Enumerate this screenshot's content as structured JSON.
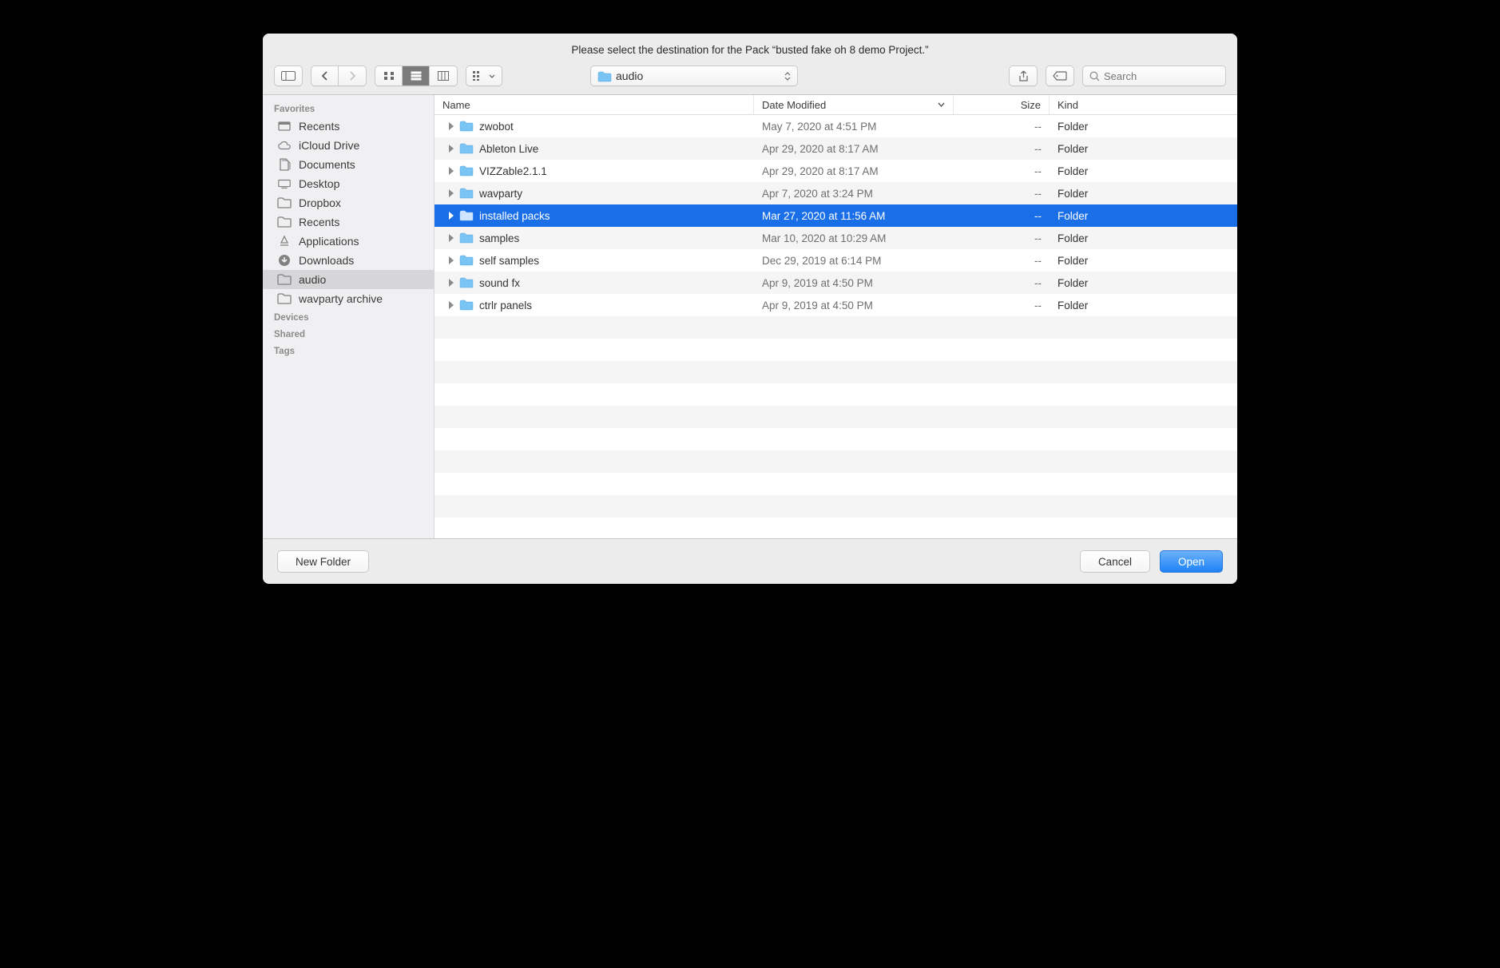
{
  "title": "Please select the destination for the Pack “busted fake oh 8 demo Project.”",
  "path_popup": {
    "label": "audio"
  },
  "search": {
    "placeholder": "Search"
  },
  "sidebar": {
    "sections": {
      "favorites": "Favorites",
      "devices": "Devices",
      "shared": "Shared",
      "tags": "Tags"
    },
    "items": [
      {
        "label": "Recents",
        "icon": "recents"
      },
      {
        "label": "iCloud Drive",
        "icon": "cloud"
      },
      {
        "label": "Documents",
        "icon": "documents"
      },
      {
        "label": "Desktop",
        "icon": "desktop"
      },
      {
        "label": "Dropbox",
        "icon": "folder"
      },
      {
        "label": "Recents",
        "icon": "folder"
      },
      {
        "label": "Applications",
        "icon": "applications"
      },
      {
        "label": "Downloads",
        "icon": "downloads"
      },
      {
        "label": "audio",
        "icon": "folder",
        "active": true
      },
      {
        "label": "wavparty archive",
        "icon": "folder"
      }
    ]
  },
  "columns": {
    "name": "Name",
    "date": "Date Modified",
    "size": "Size",
    "kind": "Kind"
  },
  "rows": [
    {
      "name": "zwobot",
      "date": "May 7, 2020 at 4:51 PM",
      "size": "--",
      "kind": "Folder"
    },
    {
      "name": "Ableton Live",
      "date": "Apr 29, 2020 at 8:17 AM",
      "size": "--",
      "kind": "Folder"
    },
    {
      "name": "VIZZable2.1.1",
      "date": "Apr 29, 2020 at 8:17 AM",
      "size": "--",
      "kind": "Folder"
    },
    {
      "name": "wavparty",
      "date": "Apr 7, 2020 at 3:24 PM",
      "size": "--",
      "kind": "Folder"
    },
    {
      "name": "installed packs",
      "date": "Mar 27, 2020 at 11:56 AM",
      "size": "--",
      "kind": "Folder",
      "selected": true
    },
    {
      "name": "samples",
      "date": "Mar 10, 2020 at 10:29 AM",
      "size": "--",
      "kind": "Folder"
    },
    {
      "name": "self samples",
      "date": "Dec 29, 2019 at 6:14 PM",
      "size": "--",
      "kind": "Folder"
    },
    {
      "name": "sound fx",
      "date": "Apr 9, 2019 at 4:50 PM",
      "size": "--",
      "kind": "Folder"
    },
    {
      "name": "ctrlr panels",
      "date": "Apr 9, 2019 at 4:50 PM",
      "size": "--",
      "kind": "Folder"
    }
  ],
  "footer": {
    "new_folder": "New Folder",
    "cancel": "Cancel",
    "open": "Open"
  }
}
